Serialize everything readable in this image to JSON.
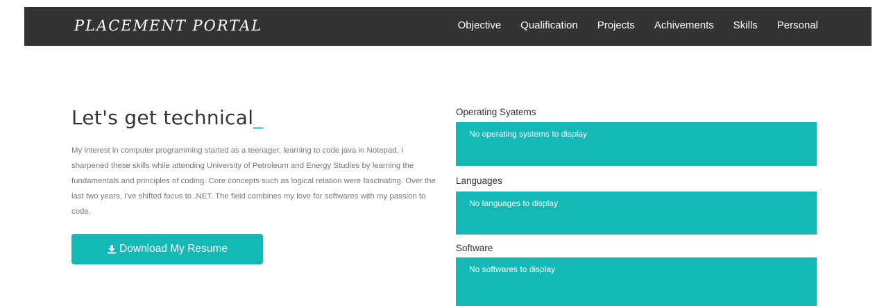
{
  "navbar": {
    "brand": "PLACEMENT PORTAL",
    "links": [
      "Objective",
      "Qualification",
      "Projects",
      "Achivements",
      "Skills",
      "Personal"
    ]
  },
  "intro": {
    "heading": "Let's get technical",
    "cursor": "_",
    "bio": "My interest in computer programming started as a teenager, learning to code java in Notepad. I sharpened these skills while attending University of Petroleum and Energy Studies by learning the fundamentals and principles of coding. Core concepts such as logical relation were fascinating. Over the last two years, I've shifted focus to .NET. The field combines my love for softwares with my passion to code.",
    "resume_button": "Download My Resume",
    "resume_icon": "download-icon"
  },
  "skills": {
    "os_label": "Operating Syatems",
    "os_empty": "No operating systems to display",
    "lang_label": "Languages",
    "lang_empty": "No languages to display",
    "software_label": "Software",
    "software_empty": "No softwares to display"
  },
  "colors": {
    "accent": "#14b8b4",
    "navbar": "#333333"
  }
}
